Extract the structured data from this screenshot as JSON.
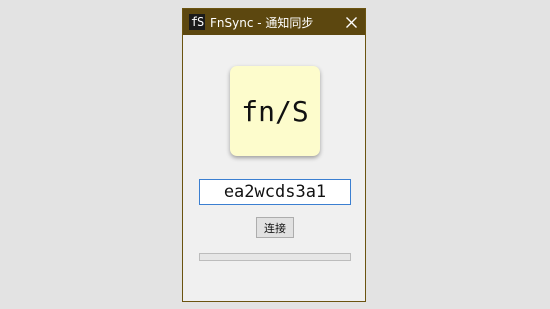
{
  "window": {
    "title": "FnSync - 通知同步",
    "app_icon_text": "fS"
  },
  "logo": {
    "text": "fn/S"
  },
  "code_field": {
    "value": "ea2wcds3a1"
  },
  "connect_button": {
    "label": "连接"
  },
  "progress": {
    "value": 0
  },
  "colors": {
    "titlebar": "#5c470f",
    "logo_background": "#fdfccc",
    "input_border": "#3b7fd1"
  },
  "icons": {
    "close": "close-icon",
    "app": "fnsync-app-icon"
  }
}
